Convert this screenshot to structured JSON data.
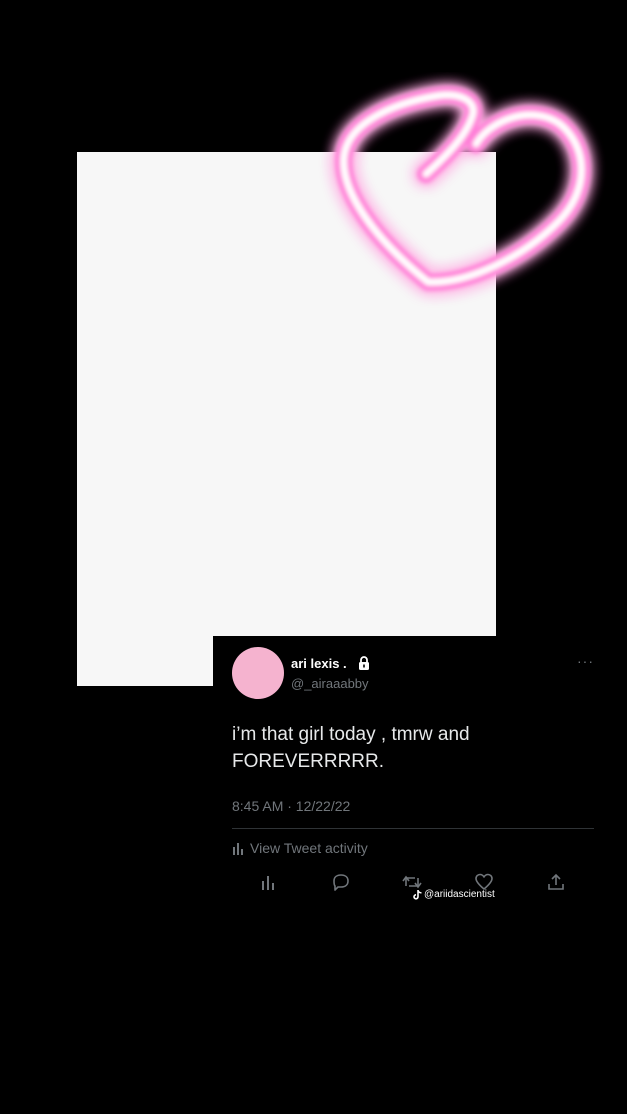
{
  "tweet": {
    "display_name": "ari lexis .",
    "handle": "@_airaaabby",
    "text": "i’m that girl today , tmrw and FOREVERRRRR.",
    "timestamp": "8:45 AM · 12/22/22",
    "activity_label": "View Tweet activity",
    "more_label": "···"
  },
  "watermark": {
    "text": "@ariidascientist"
  },
  "colors": {
    "background": "#000000",
    "frame": "#f7f7f7",
    "avatar": "#f5b3cf",
    "neon_heart": "#ff9ee6",
    "muted_text": "#71767b"
  },
  "icons": [
    "heart-neon-sticker",
    "lock-icon",
    "more-icon",
    "analytics-icon",
    "reply-icon",
    "retweet-icon",
    "like-icon",
    "share-icon",
    "tiktok-icon"
  ]
}
